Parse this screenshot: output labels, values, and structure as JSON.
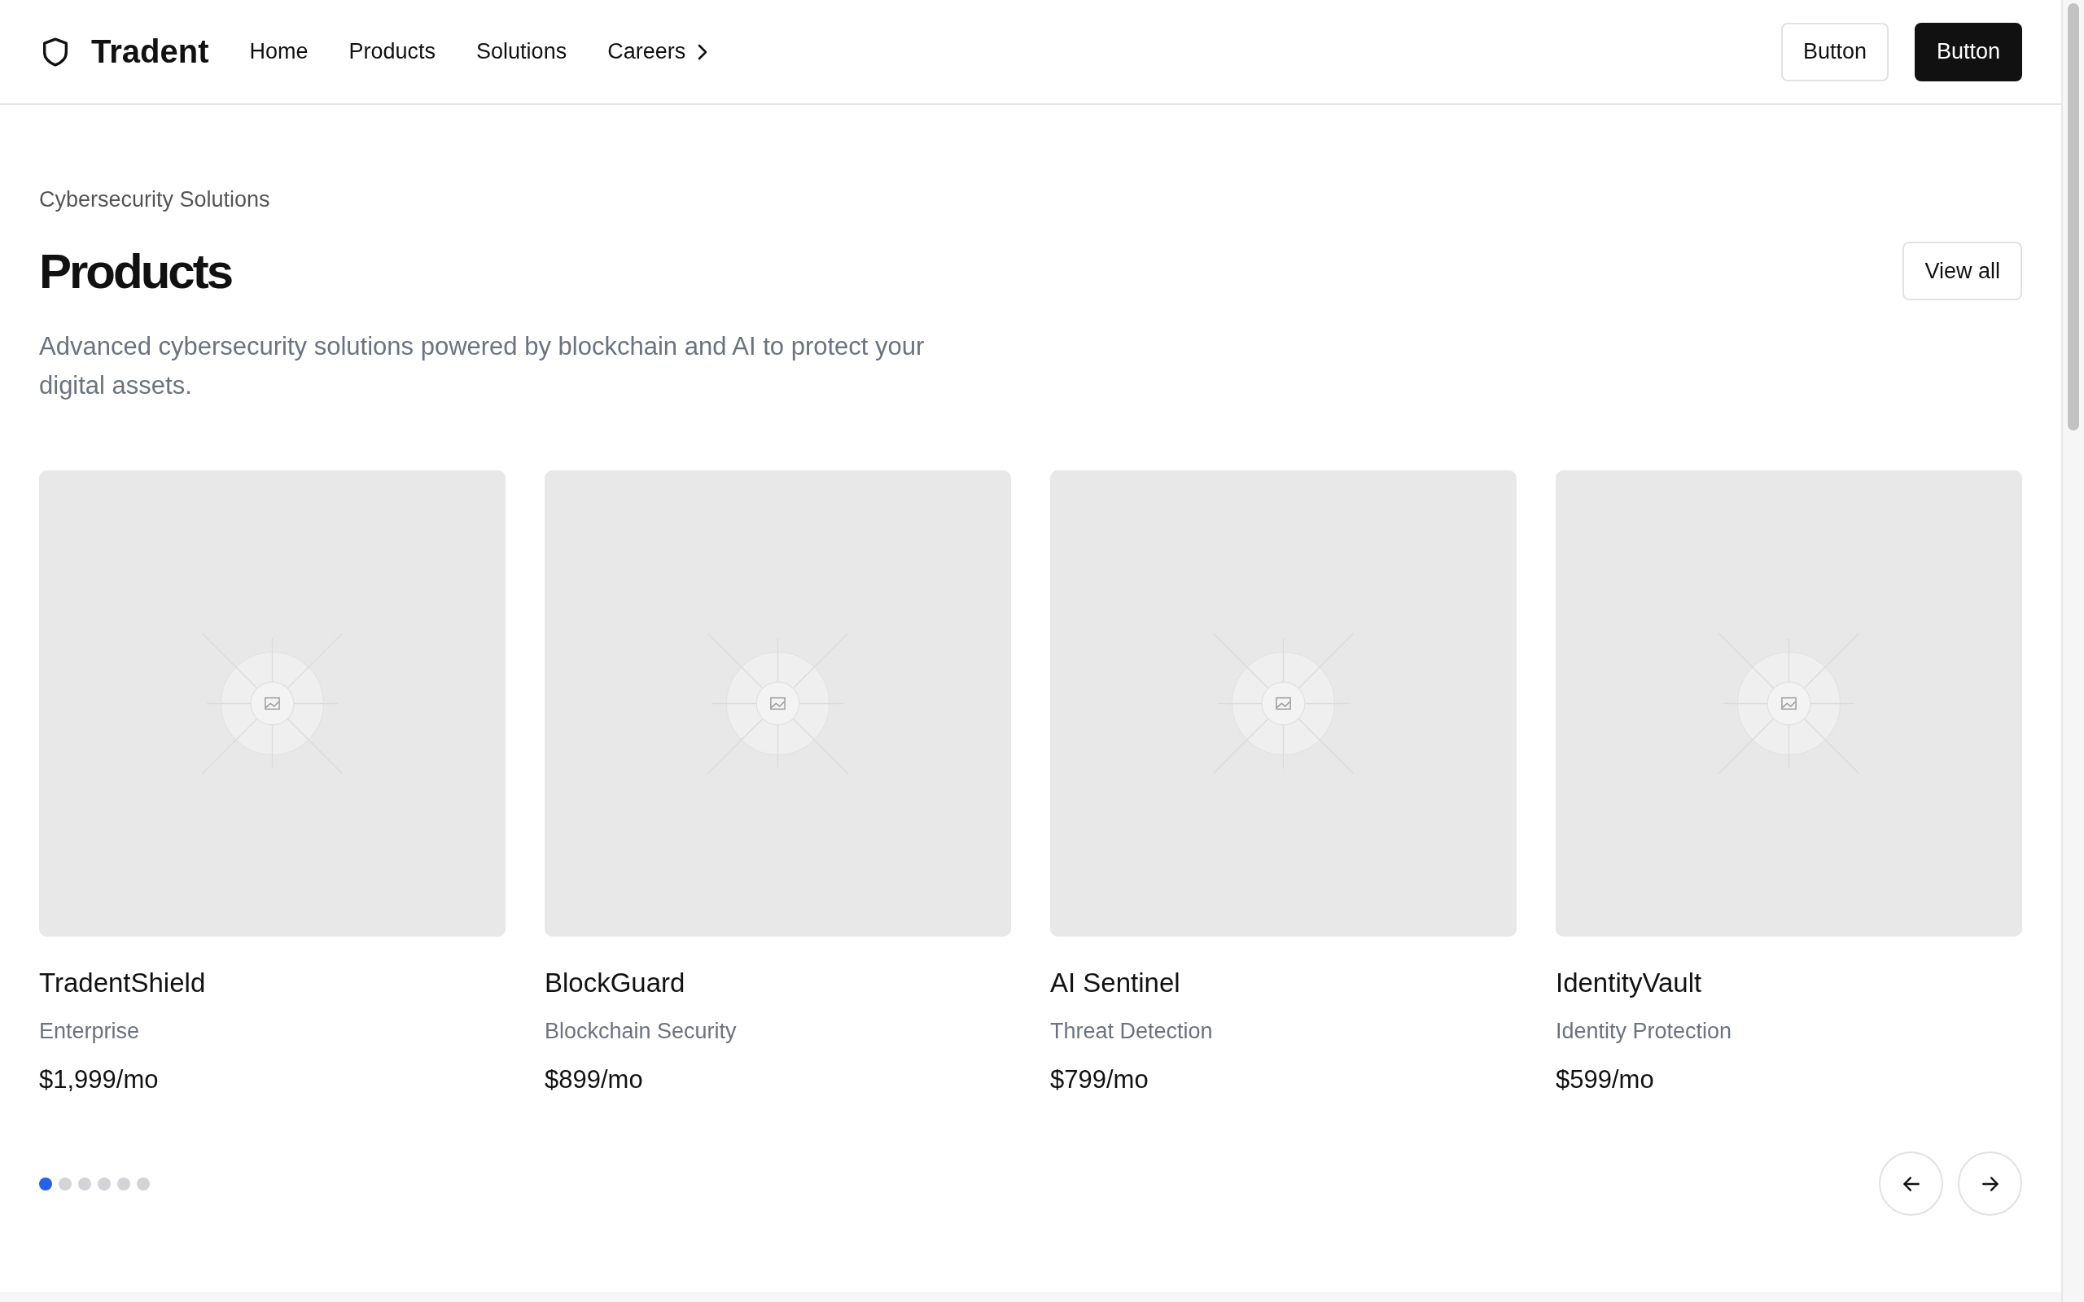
{
  "header": {
    "brand": "Tradent",
    "nav": [
      {
        "label": "Home",
        "kind": "link"
      },
      {
        "label": "Products",
        "kind": "link"
      },
      {
        "label": "Solutions",
        "kind": "link"
      },
      {
        "label": "Careers",
        "kind": "submenu"
      }
    ],
    "buttons": [
      {
        "label": "Button",
        "kind": "outline"
      },
      {
        "label": "Button",
        "kind": "solid"
      }
    ]
  },
  "section": {
    "eyebrow": "Cybersecurity Solutions",
    "title": "Products",
    "view_all": "View all",
    "description": "Advanced cybersecurity solutions powered by blockchain and AI to protect your digital assets."
  },
  "products": [
    {
      "name": "TradentShield",
      "category": "Enterprise",
      "price": "$1,999/mo"
    },
    {
      "name": "BlockGuard",
      "category": "Blockchain Security",
      "price": "$899/mo"
    },
    {
      "name": "AI Sentinel",
      "category": "Threat Detection",
      "price": "$799/mo"
    },
    {
      "name": "IdentityVault",
      "category": "Identity Protection",
      "price": "$599/mo"
    }
  ],
  "pagination": [
    {
      "selected": true
    },
    {
      "selected": false
    },
    {
      "selected": false
    },
    {
      "selected": false
    },
    {
      "selected": false
    },
    {
      "selected": false
    }
  ]
}
